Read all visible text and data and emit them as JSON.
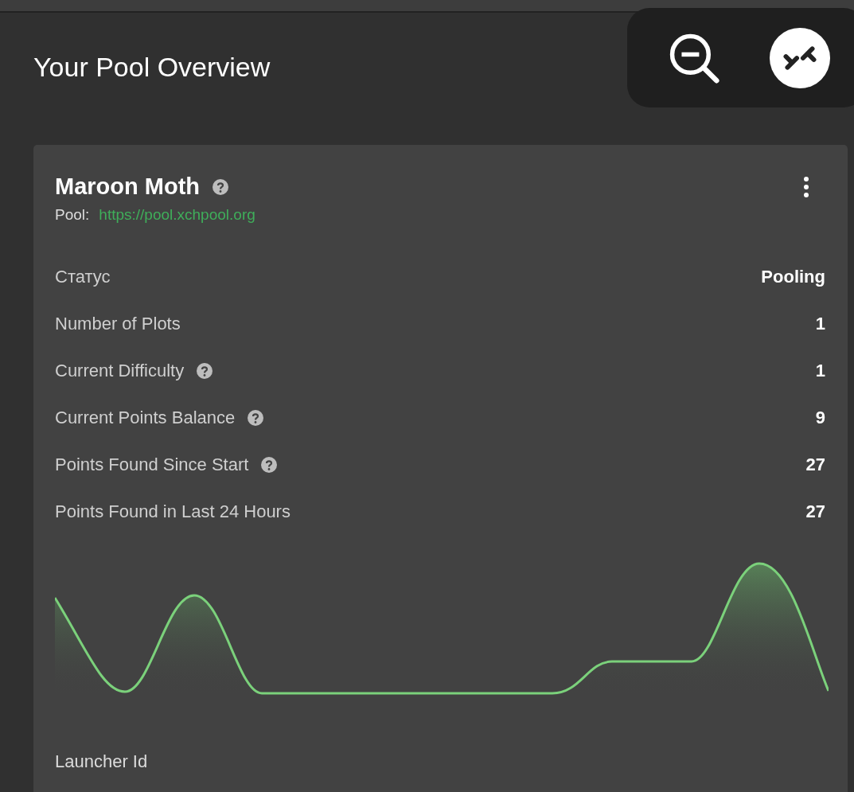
{
  "title": "Your Pool Overview",
  "card": {
    "name": "Maroon Moth",
    "name_help": true,
    "pool_label": "Pool:",
    "pool_url": "https://pool.xchpool.org",
    "rows": [
      {
        "label": "Статус",
        "value": "Pooling",
        "help": false
      },
      {
        "label": "Number of Plots",
        "value": "1",
        "help": false
      },
      {
        "label": "Current Difficulty",
        "value": "1",
        "help": true
      },
      {
        "label": "Current Points Balance",
        "value": "9",
        "help": true
      },
      {
        "label": "Points Found Since Start",
        "value": "27",
        "help": true
      },
      {
        "label": "Points Found in Last 24 Hours",
        "value": "27",
        "help": false
      }
    ],
    "footer_label": "Launcher Id"
  }
}
